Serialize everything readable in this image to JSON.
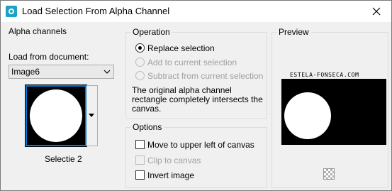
{
  "window": {
    "title": "Load Selection From Alpha Channel",
    "close_label": "close"
  },
  "alpha_channels": {
    "group_title": "Alpha channels",
    "load_from_label": "Load from document:",
    "document_value": "Image6",
    "selection_name": "Selectie 2"
  },
  "operation": {
    "group_title": "Operation",
    "replace_label": "Replace selection",
    "add_label": "Add to current selection",
    "subtract_label": "Subtract from current selection",
    "info_text": "The original alpha channel rectangle completely intersects the canvas."
  },
  "options": {
    "group_title": "Options",
    "move_label": "Move to upper left of canvas",
    "clip_label": "Clip to canvas",
    "invert_label": "Invert image"
  },
  "preview": {
    "group_title": "Preview",
    "watermark": "ESTELA-FONSECA.COM"
  }
}
